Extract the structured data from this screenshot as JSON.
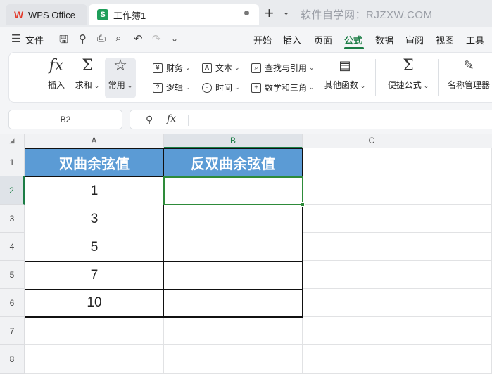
{
  "tabs": {
    "home_label": "WPS Office",
    "doc_icon": "S",
    "doc_label": "工作簿1",
    "watermark": "软件自学网：RJZXW.COM"
  },
  "menu": {
    "file": "文件",
    "items": [
      "开始",
      "插入",
      "页面",
      "公式",
      "数据",
      "审阅",
      "视图",
      "工具"
    ],
    "active": "公式"
  },
  "ribbon": {
    "insert": "插入",
    "sum": "求和",
    "common": "常用",
    "finance": "财务",
    "logic": "逻辑",
    "text": "文本",
    "time": "时间",
    "lookup": "查找与引用",
    "math": "数学和三角",
    "other": "其他函数",
    "quick": "便捷公式",
    "namemgr": "名称管理器"
  },
  "formula_bar": {
    "cell_ref": "B2",
    "fx": "fx",
    "value": ""
  },
  "sheet": {
    "columns": [
      "A",
      "B",
      "C"
    ],
    "rows": [
      "1",
      "2",
      "3",
      "4",
      "5",
      "6",
      "7",
      "8"
    ],
    "header": [
      "双曲余弦值",
      "反双曲余弦值"
    ],
    "values": [
      "1",
      "3",
      "5",
      "7",
      "10"
    ],
    "selected_cell": "B2",
    "header_fill": "#5b9bd5",
    "accent": "#1b7d45"
  }
}
